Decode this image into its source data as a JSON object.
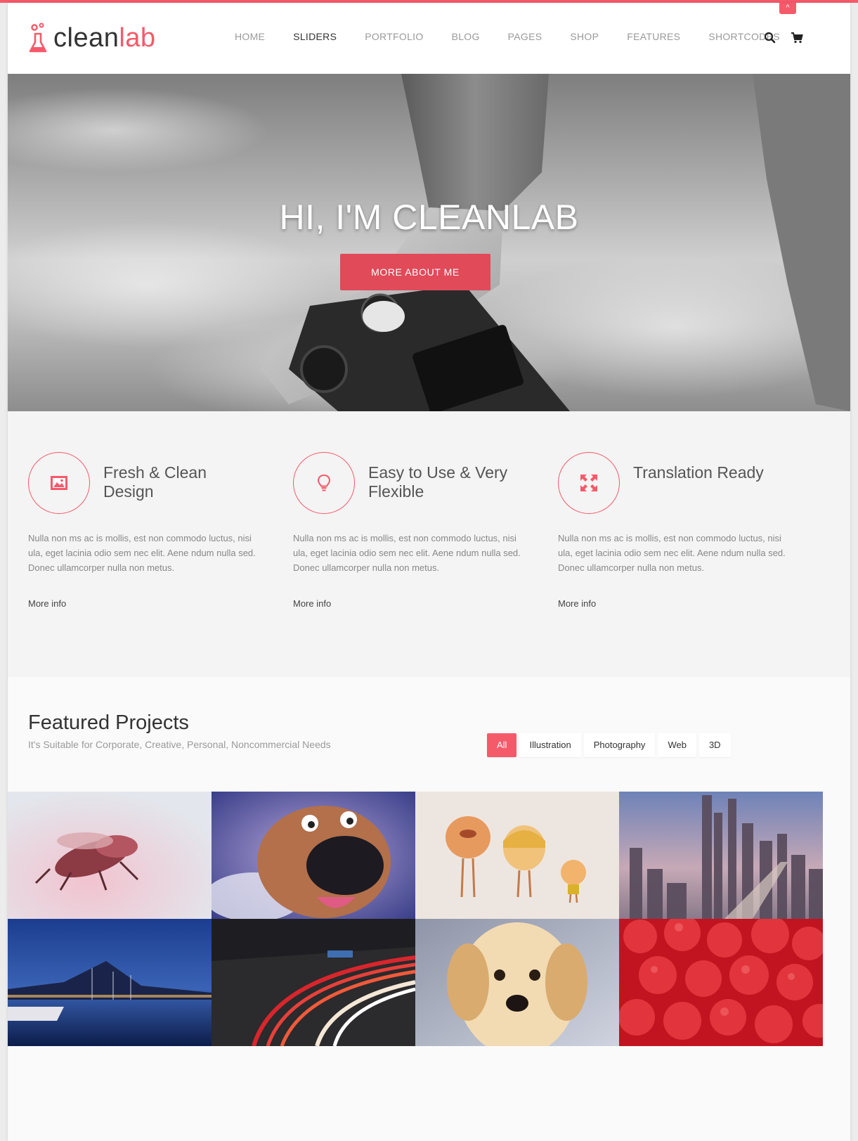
{
  "brand": {
    "name_main": "clean",
    "name_accent": "lab",
    "accent_color": "#f55a6a"
  },
  "nav": {
    "items": [
      {
        "label": "HOME"
      },
      {
        "label": "SLIDERS"
      },
      {
        "label": "PORTFOLIO"
      },
      {
        "label": "BLOG"
      },
      {
        "label": "PAGES"
      },
      {
        "label": "SHOP"
      },
      {
        "label": "FEATURES"
      },
      {
        "label": "SHORTCODES"
      }
    ],
    "active": "SLIDERS",
    "icons": [
      "search-icon",
      "cart-icon"
    ]
  },
  "scroll_top": {
    "icon": "chevron-up-icon",
    "glyph": "^"
  },
  "hero": {
    "title": "HI, I'M CLEANLAB",
    "button_label": "MORE ABOUT ME"
  },
  "features": [
    {
      "icon": "image-icon",
      "title": "Fresh & Clean Design",
      "text": "Nulla non ms ac is mollis, est non commodo luctus, nisi ula, eget lacinia odio sem nec elit. Aene ndum nulla sed. Donec ullamcorper nulla non metus.",
      "link": "More info"
    },
    {
      "icon": "lightbulb-icon",
      "title": "Easy to Use & Very Flexible",
      "text": "Nulla non ms ac is mollis, est non commodo luctus, nisi ula, eget lacinia odio sem nec elit. Aene ndum nulla sed. Donec ullamcorper nulla non metus.",
      "link": "More info"
    },
    {
      "icon": "expand-arrows-icon",
      "title": "Translation Ready",
      "text": "Nulla non ms ac is mollis, est non commodo luctus, nisi ula, eget lacinia odio sem nec elit. Aene ndum nulla sed. Donec ullamcorper nulla non metus.",
      "link": "More info"
    }
  ],
  "projects": {
    "title": "Featured Projects",
    "subtitle": "It's Suitable for Corporate, Creative, Personal, Noncommercial Needs",
    "filters": [
      "All",
      "Illustration",
      "Photography",
      "Web",
      "3D"
    ],
    "active_filter": "All",
    "tiles": [
      {
        "subject": "metal-fly-3d"
      },
      {
        "subject": "cartoon-dog"
      },
      {
        "subject": "toy-characters"
      },
      {
        "subject": "city-skyline"
      },
      {
        "subject": "marina-night"
      },
      {
        "subject": "light-trails"
      },
      {
        "subject": "puppy"
      },
      {
        "subject": "raspberries"
      }
    ]
  }
}
